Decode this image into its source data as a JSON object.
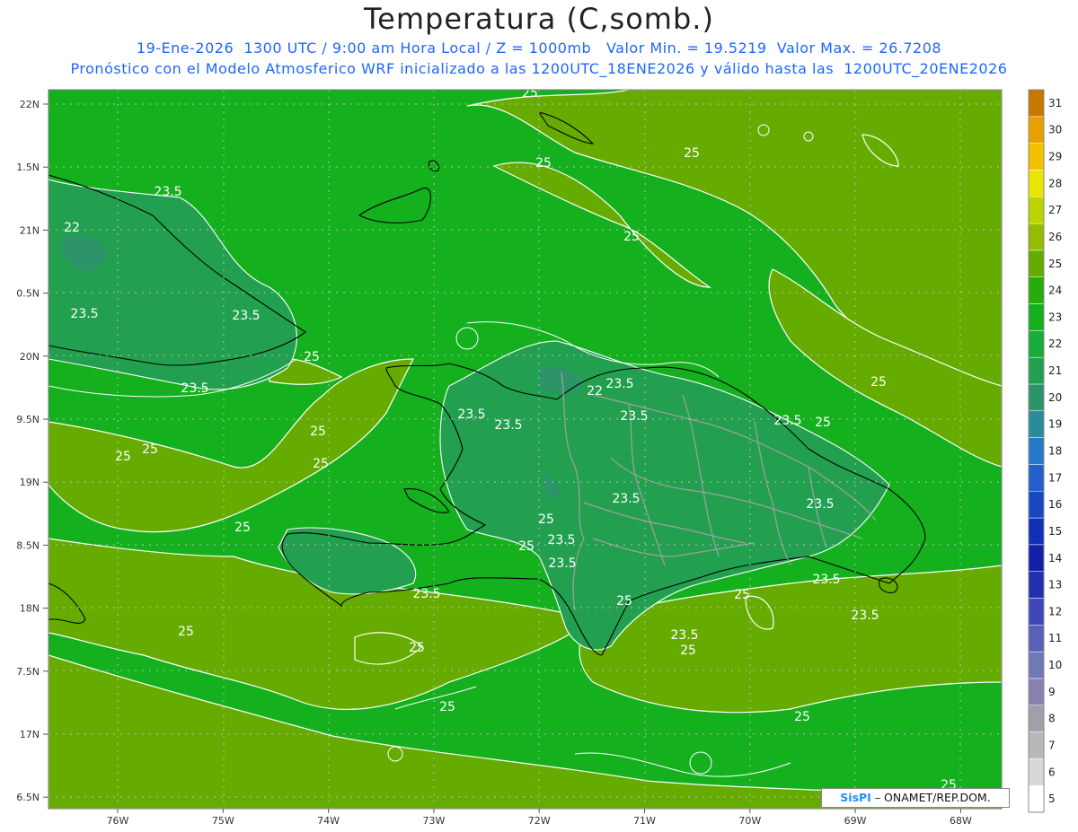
{
  "header": {
    "title": "Temperatura (C,somb.)",
    "line1": "19-Ene-2026  1300 UTC / 9:00 am Hora Local / Z = 1000mb   Valor Min. = 19.5219  Valor Max. = 26.7208",
    "line2": "Pronóstico con el Modelo Atmosferico WRF inicializado a las 1200UTC_18ENE2026 y válido hasta las  1200UTC_20ENE2026"
  },
  "axes": {
    "lat_labels": [
      "22N",
      "1.5N",
      "21N",
      "0.5N",
      "20N",
      "9.5N",
      "19N",
      "8.5N",
      "18N",
      "7.5N",
      "17N",
      "6.5N"
    ],
    "lon_labels": [
      "76W",
      "75W",
      "74W",
      "73W",
      "72W",
      "71W",
      "70W",
      "69W",
      "68W"
    ],
    "lat_range": [
      16.5,
      22.0
    ],
    "lon_range": [
      -76.7,
      -67.6
    ]
  },
  "colorbar": {
    "levels": [
      "5",
      "6",
      "7",
      "8",
      "9",
      "10",
      "11",
      "12",
      "13",
      "14",
      "15",
      "16",
      "17",
      "18",
      "19",
      "20",
      "21",
      "22",
      "23",
      "24",
      "25",
      "26",
      "27",
      "28",
      "29",
      "30",
      "31"
    ],
    "colors": [
      "#ffffff",
      "#d8d8d8",
      "#b8b8b8",
      "#a0a0a8",
      "#8a80b0",
      "#7078b8",
      "#5860b8",
      "#4048b8",
      "#2030b0",
      "#1020a8",
      "#1030b8",
      "#1848c0",
      "#2060c8",
      "#2878c8",
      "#2a8c9a",
      "#2c9468",
      "#22a050",
      "#1aac3a",
      "#14b01e",
      "#2aab0c",
      "#66ac00",
      "#94bc00",
      "#bcd400",
      "#e6e600",
      "#f2c200",
      "#e8a000",
      "#c87800"
    ]
  },
  "colors": {
    "base_field": "#14b01e",
    "warm_field": "#66ac00",
    "cool_field": "#22a050",
    "coastline": "#000000",
    "borders": "#a0a0a0",
    "contours": "#ffffff",
    "subtitle_text": "#1f66ff"
  },
  "contour_labels": [
    "25",
    "25",
    "25",
    "25",
    "23.5",
    "22",
    "23.5",
    "23.5",
    "23.5",
    "25",
    "25",
    "25",
    "23.5",
    "25",
    "23.5",
    "22",
    "23.5",
    "23.5",
    "23.5",
    "25",
    "25",
    "25",
    "23.5",
    "23.5",
    "23.5",
    "23.5",
    "25",
    "25",
    "25",
    "23.5",
    "25",
    "23.5",
    "25",
    "23.5",
    "23.5",
    "25",
    "25",
    "25",
    "25",
    "25",
    "25"
  ],
  "credit": {
    "logo": "SisPI",
    "text": "– ONAMET/REP.DOM."
  }
}
